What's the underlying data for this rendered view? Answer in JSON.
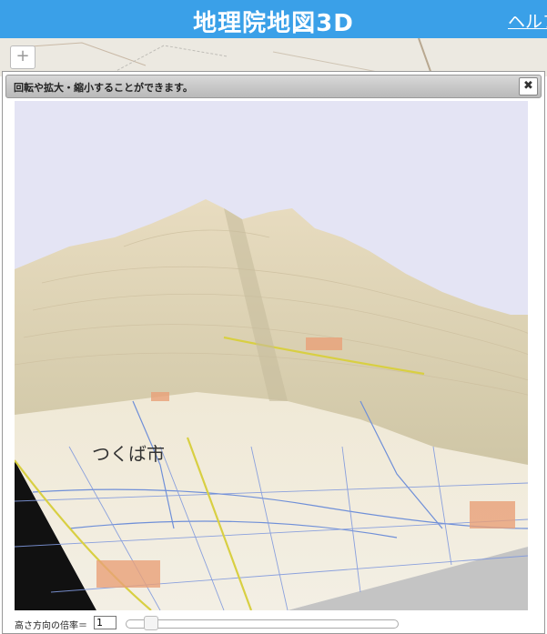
{
  "header": {
    "title": "地理院地図3D",
    "help_label": "ヘルプ"
  },
  "map_controls": {
    "zoom_in_label": "+"
  },
  "dialog": {
    "title": "回転や拡大・縮小することができます。",
    "close_label": "✖"
  },
  "terrain_view": {
    "place_label": "つくば市",
    "sky_color": "#e4e4f4"
  },
  "controls": {
    "exaggeration_label": "高さ方向の倍率＝",
    "exaggeration_value": "1",
    "slider_level": 0.07
  },
  "colors": {
    "header": "#3aa0e8"
  }
}
